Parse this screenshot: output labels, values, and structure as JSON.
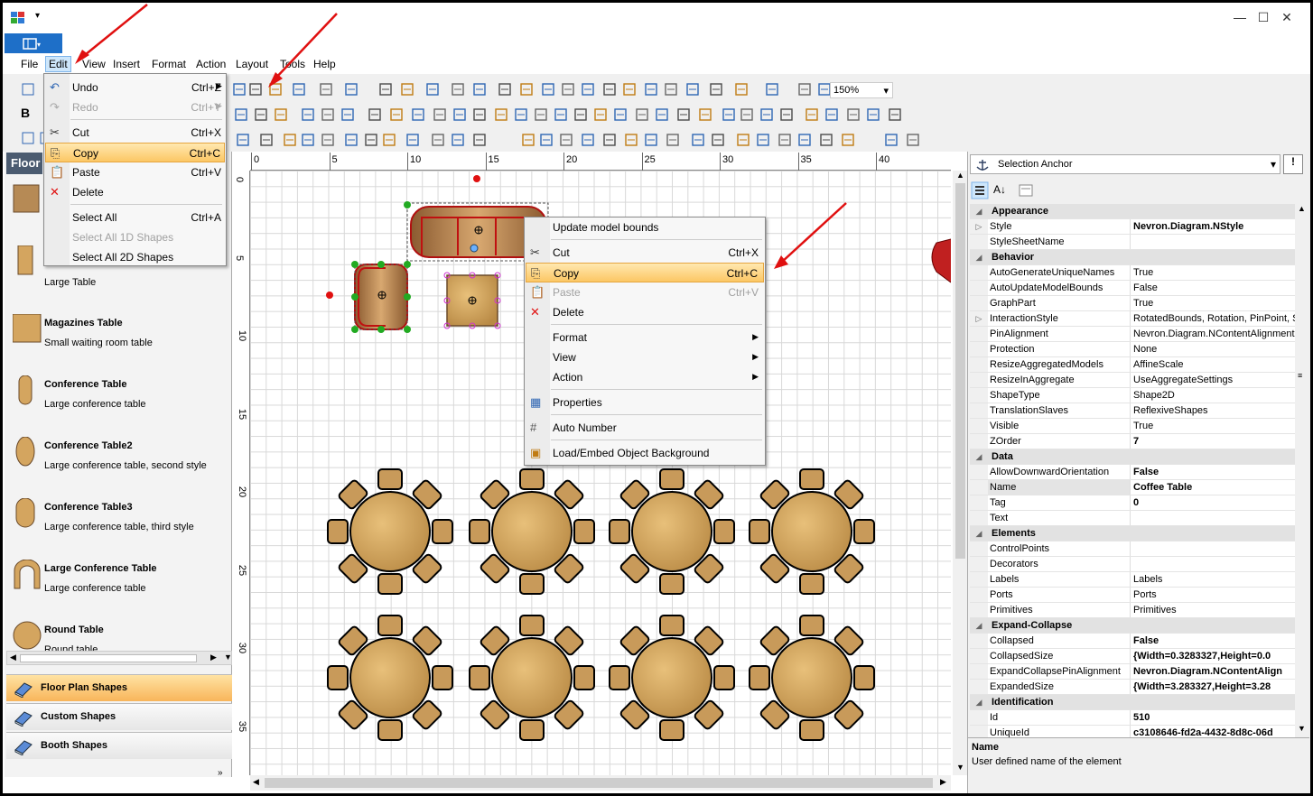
{
  "app": {
    "window_controls": {
      "minimize": "—",
      "maximize": "☐",
      "close": "✕"
    }
  },
  "menubar": {
    "items": [
      "File",
      "Edit",
      "View",
      "Insert",
      "Format",
      "Action",
      "Layout",
      "Tools",
      "Help"
    ]
  },
  "toolbar": {
    "bold": "B",
    "zoom": "150%"
  },
  "edit_menu": {
    "items": [
      {
        "label": "Undo",
        "shortcut": "Ctrl+Z"
      },
      {
        "label": "Redo",
        "shortcut": "Ctrl+Y"
      },
      {
        "label": "Cut",
        "shortcut": "Ctrl+X"
      },
      {
        "label": "Copy",
        "shortcut": "Ctrl+C"
      },
      {
        "label": "Paste",
        "shortcut": "Ctrl+V"
      },
      {
        "label": "Delete",
        "shortcut": ""
      },
      {
        "label": "Select All",
        "shortcut": "Ctrl+A"
      },
      {
        "label": "Select All 1D Shapes",
        "shortcut": ""
      },
      {
        "label": "Select All 2D Shapes",
        "shortcut": ""
      }
    ]
  },
  "context_menu": {
    "items": [
      {
        "label": "Update model bounds",
        "shortcut": ""
      },
      {
        "label": "Cut",
        "shortcut": "Ctrl+X"
      },
      {
        "label": "Copy",
        "shortcut": "Ctrl+C"
      },
      {
        "label": "Paste",
        "shortcut": "Ctrl+V"
      },
      {
        "label": "Delete",
        "shortcut": ""
      },
      {
        "label": "Format",
        "shortcut": ""
      },
      {
        "label": "View",
        "shortcut": ""
      },
      {
        "label": "Action",
        "shortcut": ""
      },
      {
        "label": "Properties",
        "shortcut": ""
      },
      {
        "label": "Auto Number",
        "shortcut": ""
      },
      {
        "label": "Load/Embed Object Background",
        "shortcut": ""
      }
    ]
  },
  "left_panel": {
    "header": "Floor",
    "shapes": [
      {
        "name": "",
        "desc": "Large Table"
      },
      {
        "name": "Magazines Table",
        "desc": "Small waiting room table"
      },
      {
        "name": "Conference Table",
        "desc": "Large conference table"
      },
      {
        "name": "Conference Table2",
        "desc": "Large conference table, second style"
      },
      {
        "name": "Conference Table3",
        "desc": "Large conference table, third style"
      },
      {
        "name": "Large Conference Table",
        "desc": "Large conference table"
      },
      {
        "name": "Round Table",
        "desc": "Round table"
      }
    ],
    "categories": [
      "Floor Plan Shapes",
      "Custom Shapes",
      "Booth Shapes"
    ]
  },
  "rulers": {
    "h": [
      "0",
      "5",
      "10",
      "15",
      "20",
      "25",
      "30",
      "35",
      "40"
    ],
    "v": [
      "0",
      "5",
      "10",
      "15",
      "20",
      "25",
      "30",
      "35"
    ]
  },
  "properties": {
    "selector": "Selection Anchor",
    "rows": [
      {
        "type": "cat",
        "name": "Appearance"
      },
      {
        "name": "Style",
        "value": "Nevron.Diagram.NStyle",
        "bold": true,
        "exp": "▷"
      },
      {
        "name": "StyleSheetName",
        "value": ""
      },
      {
        "type": "cat",
        "name": "Behavior"
      },
      {
        "name": "AutoGenerateUniqueNames",
        "value": "True"
      },
      {
        "name": "AutoUpdateModelBounds",
        "value": "False"
      },
      {
        "name": "GraphPart",
        "value": "True"
      },
      {
        "name": "InteractionStyle",
        "value": "RotatedBounds, Rotation, PinPoint, S",
        "exp": "▷"
      },
      {
        "name": "PinAlignment",
        "value": "Nevron.Diagram.NContentAlignment"
      },
      {
        "name": "Protection",
        "value": "None"
      },
      {
        "name": "ResizeAggregatedModels",
        "value": "AffineScale"
      },
      {
        "name": "ResizeInAggregate",
        "value": "UseAggregateSettings"
      },
      {
        "name": "ShapeType",
        "value": "Shape2D"
      },
      {
        "name": "TranslationSlaves",
        "value": "ReflexiveShapes"
      },
      {
        "name": "Visible",
        "value": "True"
      },
      {
        "name": "ZOrder",
        "value": "7",
        "bold": true
      },
      {
        "type": "cat",
        "name": "Data"
      },
      {
        "name": "AllowDownwardOrientation",
        "value": "False",
        "bold": true
      },
      {
        "name": "Name",
        "value": "Coffee Table",
        "bold": true
      },
      {
        "name": "Tag",
        "value": "0",
        "bold": true
      },
      {
        "name": "Text",
        "value": ""
      },
      {
        "type": "cat",
        "name": "Elements"
      },
      {
        "name": "ControlPoints",
        "value": ""
      },
      {
        "name": "Decorators",
        "value": ""
      },
      {
        "name": "Labels",
        "value": "Labels"
      },
      {
        "name": "Ports",
        "value": "Ports"
      },
      {
        "name": "Primitives",
        "value": "Primitives"
      },
      {
        "type": "cat",
        "name": "Expand-Collapse"
      },
      {
        "name": "Collapsed",
        "value": "False",
        "bold": true
      },
      {
        "name": "CollapsedSize",
        "value": "{Width=0.3283327,Height=0.0",
        "bold": true
      },
      {
        "name": "ExpandCollapsePinAlignment",
        "value": "Nevron.Diagram.NContentAlign",
        "bold": true
      },
      {
        "name": "ExpandedSize",
        "value": "{Width=3.283327,Height=3.28",
        "bold": true
      },
      {
        "type": "cat",
        "name": "Identification"
      },
      {
        "name": "Id",
        "value": "510",
        "bold": true
      },
      {
        "name": "UniqueId",
        "value": "c3108646-fd2a-4432-8d8c-06d",
        "bold": true
      }
    ],
    "desc_title": "Name",
    "desc_text": "User defined name of the element"
  }
}
